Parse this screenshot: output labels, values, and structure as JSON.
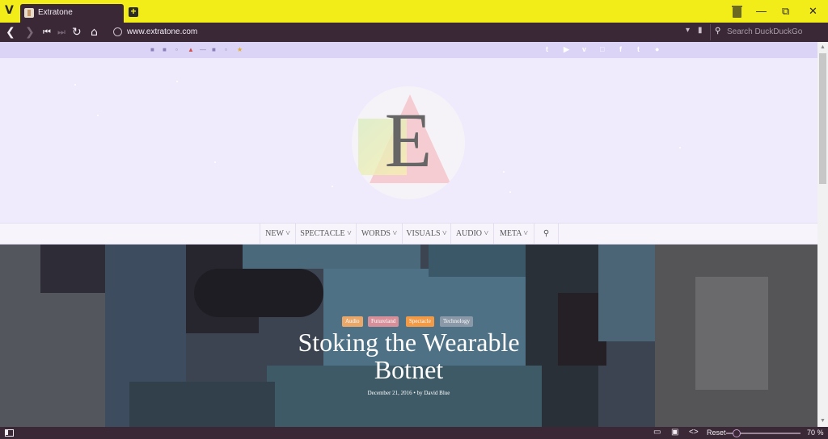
{
  "browser": {
    "tab_title": "Extratone",
    "new_tab_symbol": "+",
    "url": "www.extratone.com",
    "search_placeholder": "Search DuckDuckGo",
    "zoom_reset_label": "Reset",
    "zoom_level": "70 %",
    "zoom_fraction": 0.1,
    "accent_color": "#f2ec19",
    "chrome_color": "#3a2837"
  },
  "site": {
    "logo_letter": "E",
    "menu": [
      {
        "label": "NEW"
      },
      {
        "label": "SPECTACLE"
      },
      {
        "label": "WORDS"
      },
      {
        "label": "VISUALS"
      },
      {
        "label": "AUDIO"
      },
      {
        "label": "META"
      }
    ],
    "menu_search_icon": "search-icon",
    "top_social_icons": [
      "twitter-icon",
      "youtube-icon",
      "vimeo-icon",
      "instagram-icon",
      "facebook-icon",
      "tumblr-icon",
      "snapchat-icon"
    ],
    "hero": {
      "tags": [
        {
          "label": "Audio",
          "color": "#e9a86a"
        },
        {
          "label": "Futureland",
          "color": "#d78f9a"
        },
        {
          "label": "Spectacle",
          "color": "#f29a45"
        },
        {
          "label": "Technology",
          "color": "#8a98a8"
        }
      ],
      "title_line1": "Stoking the Wearable",
      "title_line2": "Botnet",
      "date": "December 21, 2016",
      "byline_sep": "•",
      "by_label": "by",
      "author": "David Blue"
    }
  }
}
